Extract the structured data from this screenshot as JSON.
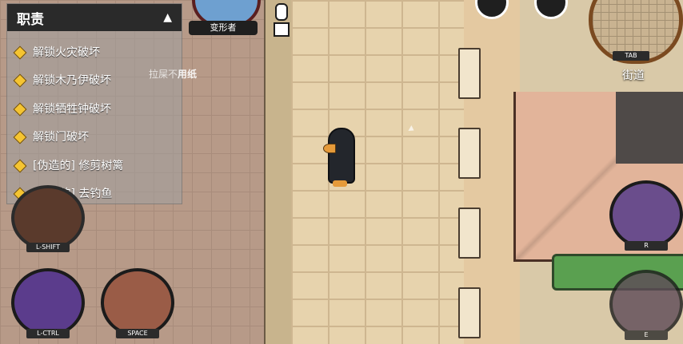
{
  "task_panel": {
    "title": "职责",
    "collapse_icon": "triangle-up-icon",
    "items": [
      {
        "label": "解锁火灾破坏"
      },
      {
        "label": "解锁木乃伊破坏"
      },
      {
        "label": "解锁牺牲钟破坏"
      },
      {
        "label": "解锁门破坏"
      },
      {
        "label": "[伪造的] 修剪树篱"
      },
      {
        "label": "[伪造的] 去钓鱼"
      }
    ]
  },
  "role": {
    "label": "变形者"
  },
  "hint": {
    "prefix": "拉屎不",
    "emphasis": "用纸"
  },
  "minimap": {
    "key": "TAB"
  },
  "location": {
    "name": "街道"
  },
  "skills": {
    "shift": {
      "key": "L-SHIFT"
    },
    "ctrl": {
      "key": "L-CTRL"
    },
    "space": {
      "key": "SPACE"
    },
    "r": {
      "key": "R"
    },
    "e": {
      "key": "E"
    }
  },
  "colors": {
    "panel_header": "#2a2a2a",
    "task_icon": "#f5c431",
    "minimap_border": "#7b4a20"
  }
}
